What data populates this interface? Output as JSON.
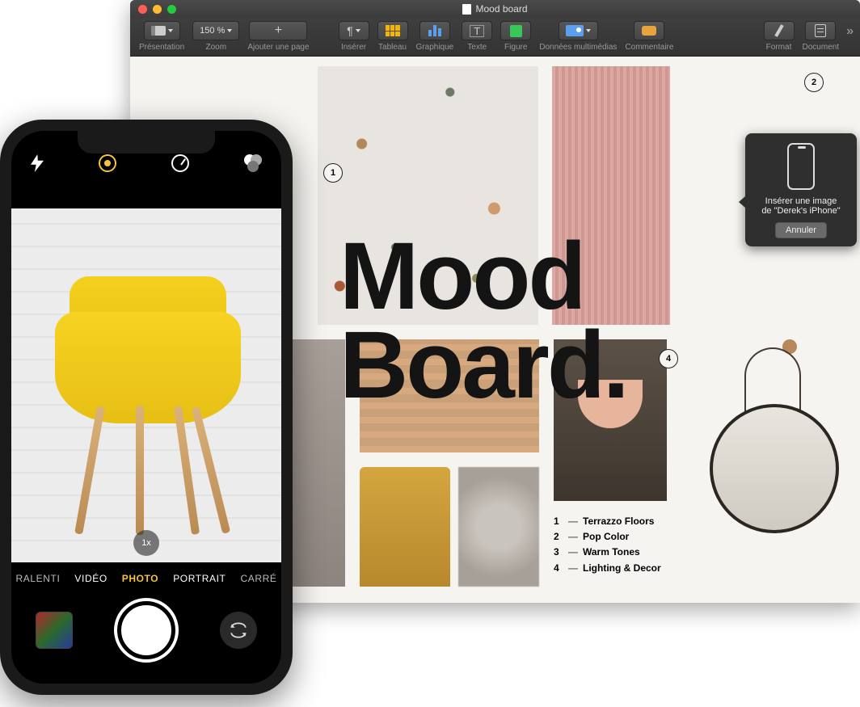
{
  "pages": {
    "title": "Mood board",
    "toolbar": {
      "presentation": "Présentation",
      "zoom_value": "150 %",
      "zoom": "Zoom",
      "add_page": "Ajouter une page",
      "insert": "Insérer",
      "table": "Tableau",
      "chart": "Graphique",
      "text": "Texte",
      "shape": "Figure",
      "media": "Données multimédias",
      "comment": "Commentaire",
      "format": "Format",
      "document": "Document"
    },
    "document": {
      "headline_l1": "Mood",
      "headline_l2": "Board.",
      "badges": {
        "b1": "1",
        "b2": "2",
        "b4": "4"
      },
      "legend": [
        {
          "n": "1",
          "label": "Terrazzo Floors"
        },
        {
          "n": "2",
          "label": "Pop Color"
        },
        {
          "n": "3",
          "label": "Warm Tones"
        },
        {
          "n": "4",
          "label": "Lighting & Decor"
        }
      ]
    },
    "popover": {
      "line1": "Insérer une image",
      "line2": "de \"Derek's iPhone\"",
      "cancel": "Annuler"
    }
  },
  "iphone": {
    "zoom": "1x",
    "modes": {
      "ralenti": "RALENTI",
      "video": "VIDÉO",
      "photo": "PHOTO",
      "portrait": "PORTRAIT",
      "carre": "CARRÉ"
    }
  }
}
